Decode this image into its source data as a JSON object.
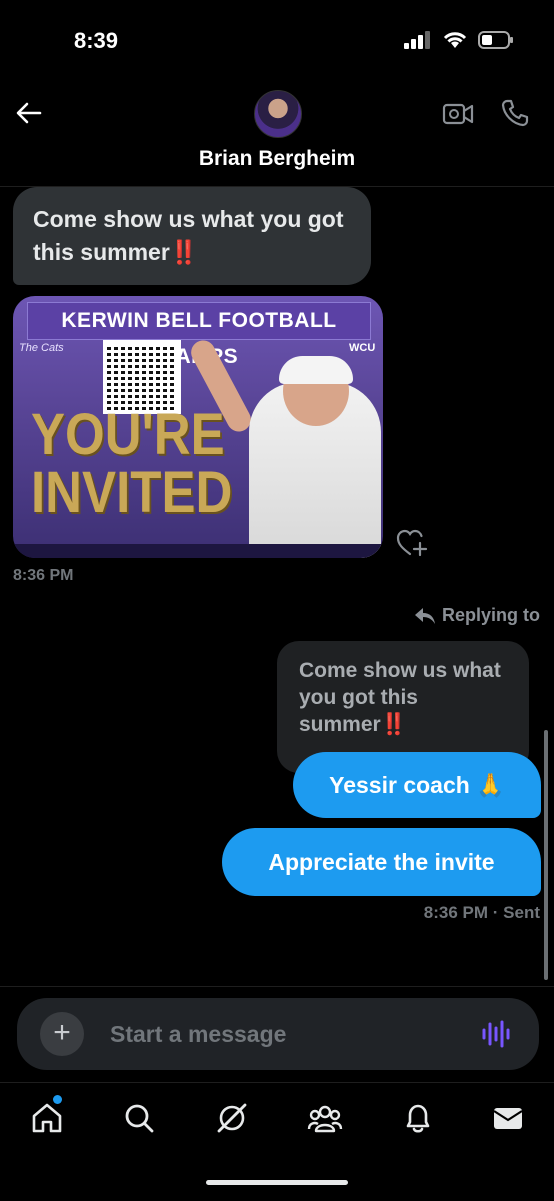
{
  "status_bar": {
    "time": "8:39"
  },
  "header": {
    "contact_name": "Brian Bergheim"
  },
  "messages": {
    "incoming_text": "Come show us what you got this summer‼️",
    "card": {
      "banner": "KERWIN BELL FOOTBALL CAMPS",
      "headline_line1": "YOU'RE",
      "headline_line2": "INVITED",
      "logo_left": "The Cats",
      "logo_right": "WCU"
    },
    "incoming_time": "8:36 PM",
    "reply_label": "Replying to",
    "quoted_text": "Come show us what you got this summer‼️",
    "outgoing": [
      {
        "text": "Yessir coach 🙏"
      },
      {
        "text": "Appreciate the invite"
      }
    ],
    "outgoing_time": "8:36 PM",
    "outgoing_status": "· Sent"
  },
  "composer": {
    "placeholder": "Start a message"
  },
  "colors": {
    "accent": "#1d9bf0",
    "voice_icon": "#7856ff"
  },
  "tabs": [
    "home-icon",
    "search-icon",
    "grok-icon",
    "communities-icon",
    "notifications-icon",
    "messages-icon"
  ]
}
